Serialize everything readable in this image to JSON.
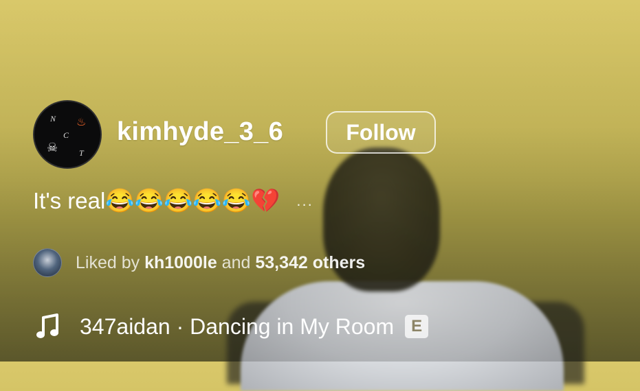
{
  "post": {
    "username": "kimhyde_3_6",
    "follow_label": "Follow",
    "avatar": {
      "letters": [
        "N",
        "C",
        "T"
      ],
      "icons": [
        "flame-icon",
        "skull-icon"
      ]
    },
    "caption": {
      "text": "It's real",
      "emojis": [
        "😂",
        "😂",
        "😂",
        "😂",
        "😂",
        "💔"
      ],
      "more": "..."
    },
    "likes": {
      "prefix": "Liked by",
      "user": "kh1000le",
      "conjunction": "and",
      "count": "53,342 others"
    },
    "music": {
      "artist": "347aidan",
      "separator": "·",
      "title": "Dancing in My Room",
      "explicit": "E"
    }
  },
  "colors": {
    "background_top": "#d9c86a",
    "background_bottom": "#6f6a34",
    "text": "#ffffff"
  }
}
